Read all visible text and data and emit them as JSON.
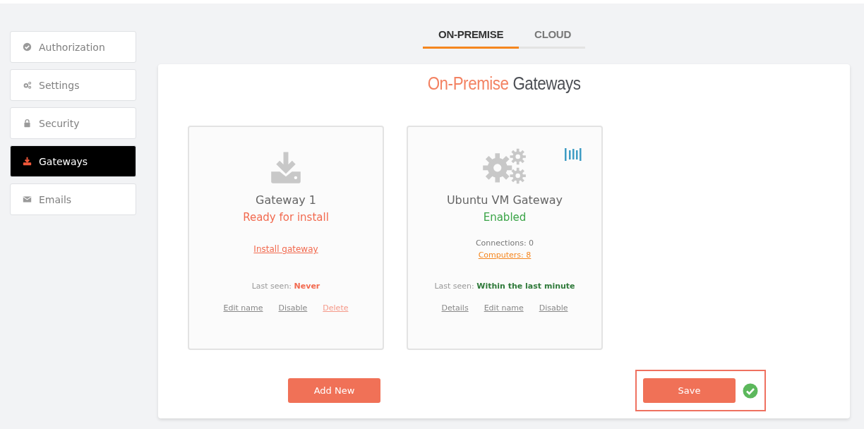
{
  "sidebar": {
    "items": [
      {
        "label": "Authorization",
        "kind": "check",
        "selected": false
      },
      {
        "label": "Settings",
        "kind": "gears",
        "selected": false
      },
      {
        "label": "Security",
        "kind": "lock",
        "selected": false
      },
      {
        "label": "Gateways",
        "kind": "download",
        "selected": true
      },
      {
        "label": "Emails",
        "kind": "mail",
        "selected": false
      }
    ]
  },
  "tabs": [
    {
      "label": "ON-PREMISE",
      "selected": true
    },
    {
      "label": "CLOUD",
      "selected": false
    }
  ],
  "panel": {
    "title_accent": "On-Premise",
    "title_rest": "Gateways",
    "cards": [
      {
        "kind": "pending",
        "name": "Gateway 1",
        "status": "Ready for install",
        "signal": false,
        "action_link": "Install gateway",
        "last_seen_label": "Last seen:",
        "last_seen": "Never",
        "links": [
          {
            "label": "Edit name",
            "kind": "plain"
          },
          {
            "label": "Disable",
            "kind": "plain"
          },
          {
            "label": "Delete",
            "kind": "danger"
          }
        ]
      },
      {
        "kind": "ok",
        "name": "Ubuntu VM Gateway",
        "status": "Enabled",
        "signal": true,
        "stats": [
          {
            "label": "Connections: 0",
            "kind": "text"
          },
          {
            "label": "Computers: 8",
            "kind": "link"
          }
        ],
        "last_seen_label": "Last seen:",
        "last_seen": "Within the last minute",
        "links": [
          {
            "label": "Details",
            "kind": "plain"
          },
          {
            "label": "Edit name",
            "kind": "plain"
          },
          {
            "label": "Disable",
            "kind": "plain"
          }
        ]
      }
    ],
    "add_button": "Add New",
    "save_button": {
      "label": "Save",
      "highlighted": true,
      "saved": true
    }
  }
}
